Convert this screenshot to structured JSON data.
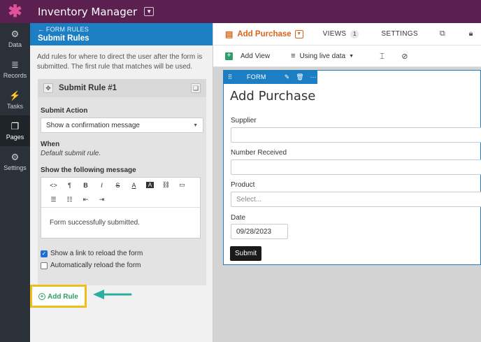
{
  "app": {
    "title": "Inventory Manager",
    "logo": "asterisk-logo"
  },
  "leftnav": [
    {
      "label": "Data",
      "icon": "data-icon",
      "glyph": "⚙"
    },
    {
      "label": "Records",
      "icon": "records-icon",
      "glyph": "≣"
    },
    {
      "label": "Tasks",
      "icon": "tasks-icon",
      "glyph": "⚡"
    },
    {
      "label": "Pages",
      "icon": "pages-icon",
      "glyph": "❐"
    },
    {
      "label": "Settings",
      "icon": "settings-icon",
      "glyph": "⚙"
    }
  ],
  "panel": {
    "back_label": "← FORM RULES",
    "title": "Submit Rules",
    "intro": "Add rules for where to direct the user after the form is submitted. The first rule that matches will be used.",
    "rule": {
      "title": "Submit Rule #1",
      "action_label": "Submit Action",
      "action_value": "Show a confirmation message",
      "when_label": "When",
      "when_value": "Default submit rule.",
      "message_label": "Show the following message",
      "toolbar_row1": [
        "<>",
        "¶",
        "B",
        "I",
        "S",
        "A",
        "A",
        "⛓",
        "▭"
      ],
      "toolbar_row2": [
        "☰",
        "☷",
        "⇤",
        "⇥"
      ],
      "message_text": "Form successfully submitted.",
      "check_reload_link": "Show a link to reload the form",
      "check_auto_reload": "Automatically reload the form"
    },
    "add_rule": "Add Rule"
  },
  "main": {
    "tab_active": "Add Purchase",
    "tab_views": "VIEWS",
    "views_count": "1",
    "tab_settings": "SETTINGS",
    "add_view": "Add View",
    "live_data": "Using live data",
    "form_bar_label": "FORM",
    "form": {
      "title": "Add Purchase",
      "supplier_label": "Supplier",
      "number_label": "Number Received",
      "product_label": "Product",
      "product_placeholder": "Select...",
      "date_label": "Date",
      "date_value": "09/28/2023",
      "submit": "Submit"
    }
  },
  "colors": {
    "topbar": "#5b2050",
    "accent_blue": "#1c7fc4",
    "accent_orange": "#d9661a",
    "accent_green": "#2f9e68",
    "highlight_yellow": "#f0be1b"
  }
}
